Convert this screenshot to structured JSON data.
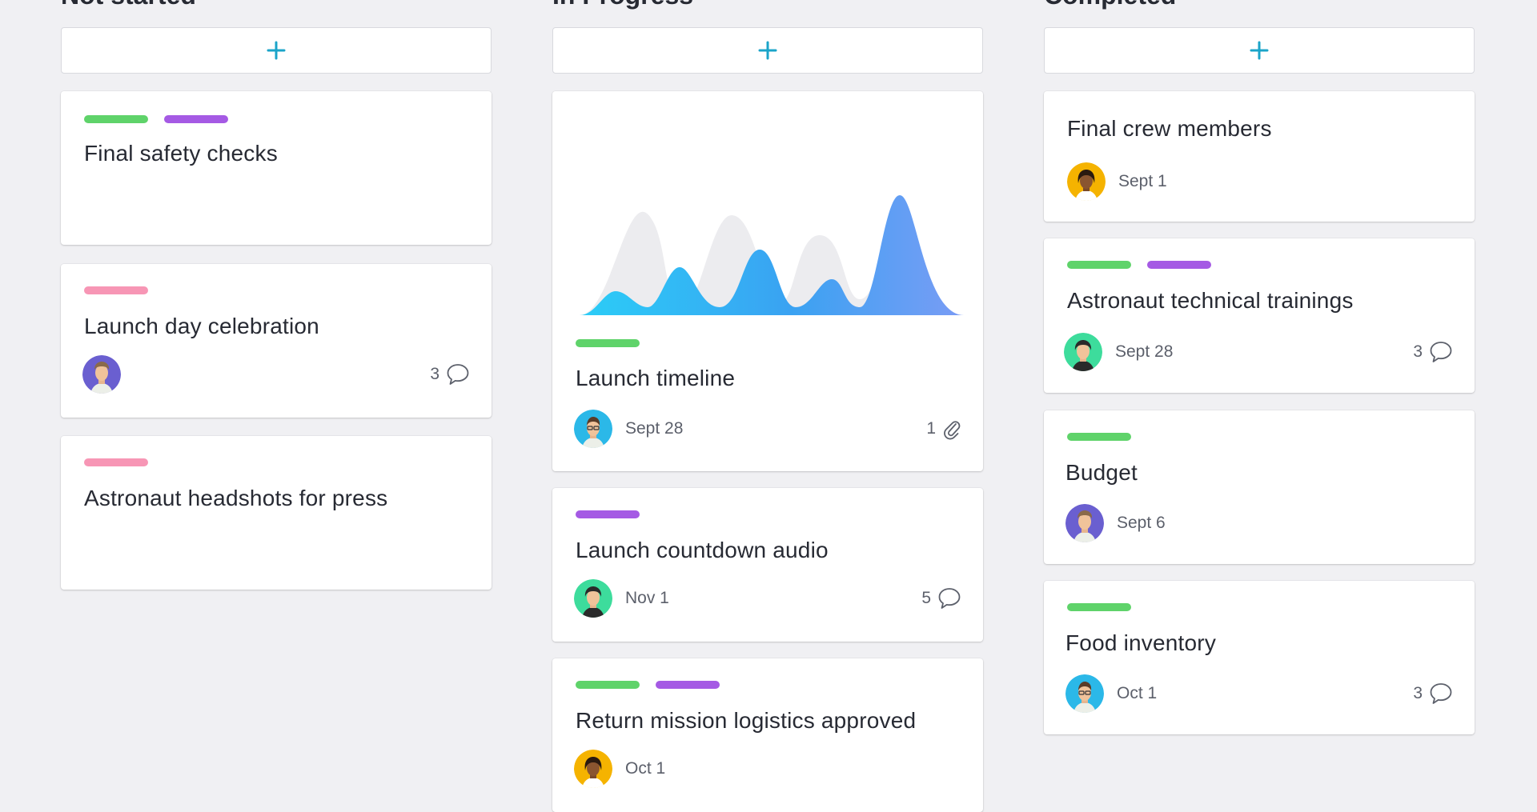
{
  "columns": [
    {
      "title": "Not started",
      "add_label": "+",
      "cards": [
        {
          "title": "Final safety checks",
          "tags": [
            "green",
            "purple"
          ]
        },
        {
          "title": "Launch day celebration",
          "tags": [
            "pink"
          ],
          "comments": "3"
        },
        {
          "title": "Astronaut headshots for press",
          "tags": [
            "pink"
          ]
        }
      ]
    },
    {
      "title": "In Progress",
      "add_label": "+",
      "cards": [
        {
          "title": "Launch timeline",
          "tags": [
            "green"
          ],
          "date": "Sept 28",
          "attachments": "1"
        },
        {
          "title": "Launch countdown audio",
          "tags": [
            "purple"
          ],
          "date": "Nov 1",
          "comments": "5"
        },
        {
          "title": "Return mission logistics approved",
          "tags": [
            "green",
            "purple"
          ],
          "date": "Oct 1"
        }
      ]
    },
    {
      "title": "Completed",
      "add_label": "+",
      "cards": [
        {
          "title": "Final crew members",
          "date": "Sept 1"
        },
        {
          "title": "Astronaut technical trainings",
          "tags": [
            "green",
            "purple"
          ],
          "date": "Sept 28",
          "comments": "3"
        },
        {
          "title": "Budget",
          "tags": [
            "green"
          ],
          "date": "Sept 6"
        },
        {
          "title": "Food inventory",
          "tags": [
            "green"
          ],
          "date": "Oct 1",
          "comments": "3"
        }
      ]
    }
  ],
  "colors": {
    "tag_green": "#5fd36a",
    "tag_purple": "#a55ae4",
    "tag_pink": "#f796b5",
    "accent": "#1ba4c9"
  },
  "icons": {
    "add": "plus-icon",
    "comment": "comment-icon",
    "attachment": "paperclip-icon",
    "chart": "area-chart-illustration"
  }
}
